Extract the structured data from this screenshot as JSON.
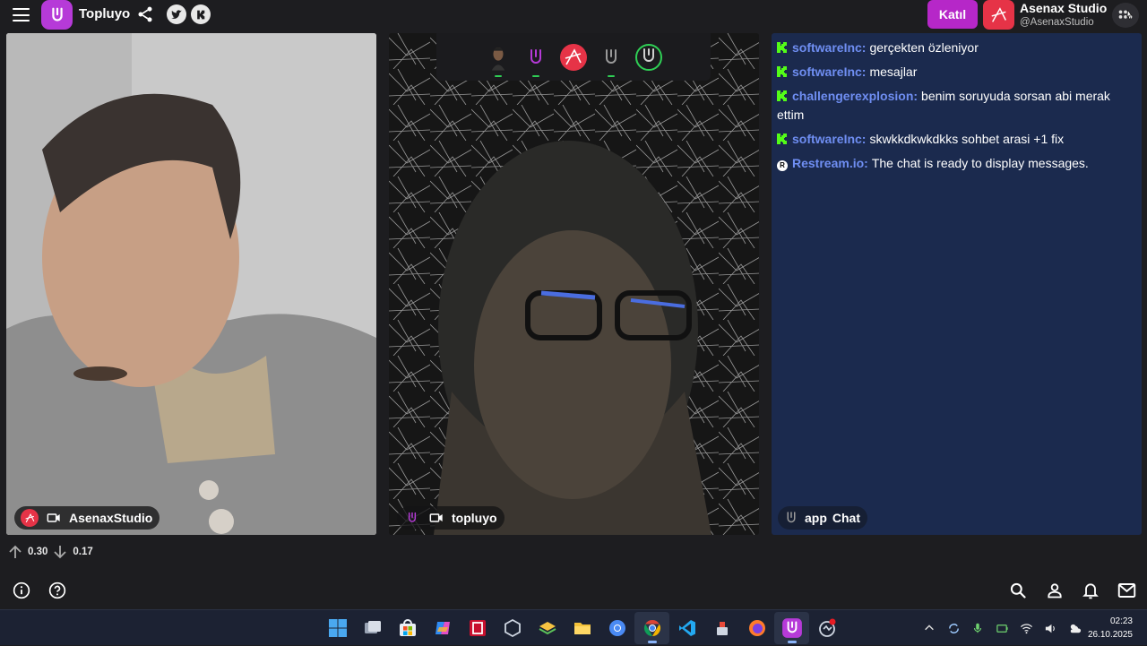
{
  "header": {
    "brand_name": "Topluyo",
    "join_label": "Katıl",
    "user_name": "Asenax Studio",
    "user_handle": "@AsenaxStudio"
  },
  "tiles": [
    {
      "label": "AsenaxStudio"
    },
    {
      "label": "topluyo"
    }
  ],
  "chat": {
    "messages": [
      {
        "platform": "kick",
        "user": "softwareInc:",
        "text": "gerçekten özleniyor"
      },
      {
        "platform": "kick",
        "user": "softwareInc:",
        "text": "mesajlar"
      },
      {
        "platform": "kick",
        "user": "challengerexplosion:",
        "text": "benim soruyuda sorsan abi merak ettim"
      },
      {
        "platform": "kick",
        "user": "softwareInc:",
        "text": "skwkkdkwkdkks sohbet arasi +1 fix"
      },
      {
        "platform": "restream",
        "user": "Restream.io:",
        "text": "The chat is ready to display messages."
      }
    ],
    "footer_app": "app",
    "footer_label": "Chat"
  },
  "stats": {
    "upload": "0.30",
    "download": "0.17"
  },
  "taskbar": {
    "time": "02:23",
    "date": "26.10.2025",
    "apps": [
      "windows-start-icon",
      "task-view-icon",
      "store-icon",
      "copilot-icon",
      "app-red-icon",
      "obs-icon",
      "layers-icon",
      "file-explorer-icon",
      "chrome-icon",
      "chrome-profile-icon",
      "vscode-icon",
      "usb-tool-icon",
      "firefox-icon",
      "topluyo-icon",
      "recording-icon"
    ]
  },
  "colors": {
    "brand": "#b63ad8",
    "join": "#b627c8",
    "avatar": "#e63347",
    "chat_bg": "#1b2a4e",
    "chat_user": "#6f8ef2",
    "kick_green": "#53fc18"
  }
}
